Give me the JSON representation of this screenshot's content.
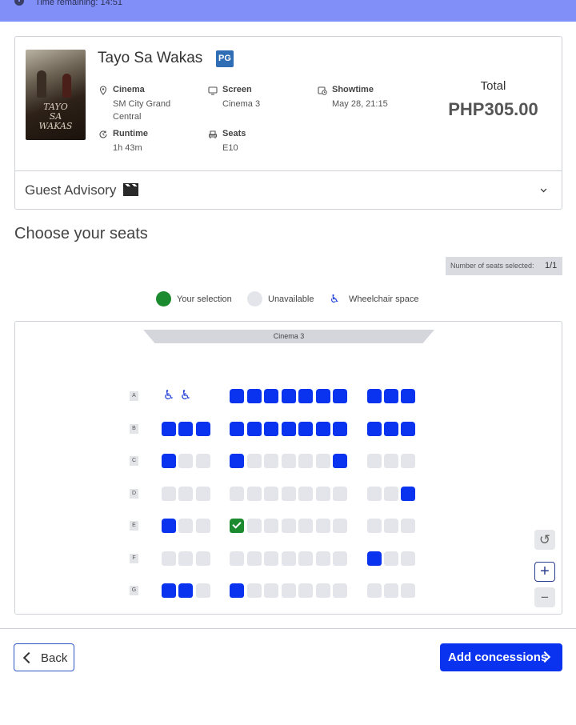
{
  "timer": {
    "text": "Time remaining: 14:51"
  },
  "movie": {
    "title": "Tayo Sa Wakas",
    "rating": "PG",
    "poster_title": "TAYO SA WAKAS",
    "cinema_label": "Cinema",
    "cinema_value": "SM City Grand Central",
    "screen_label": "Screen",
    "screen_value": "Cinema 3",
    "showtime_label": "Showtime",
    "showtime_value": "May 28, 21:15",
    "runtime_label": "Runtime",
    "runtime_value": "1h 43m",
    "seats_label": "Seats",
    "seats_value": "E10",
    "total_label": "Total",
    "total_value": "PHP305.00"
  },
  "advisory": {
    "label": "Guest Advisory"
  },
  "seat_selection": {
    "title": "Choose your seats",
    "count_label": "Number of seats selected:",
    "count_value": "1/1"
  },
  "legend": {
    "selection": "Your selection",
    "unavailable": "Unavailable",
    "wheelchair": "Wheelchair space",
    "colors": {
      "selection": "#1c8a2e",
      "unavailable": "#e4e5ea",
      "available": "#0a33f0"
    }
  },
  "seat_map": {
    "screen_label": "Cinema 3",
    "status_key": "w = wheelchair space, a = available, u = unavailable, s = your selection, - = no seat",
    "rows": [
      {
        "label": "A",
        "seats": "ww-aaaaaaaaaa"
      },
      {
        "label": "B",
        "seats": "aaaaaaaaaaaaa"
      },
      {
        "label": "C",
        "seats": "auuauuuuuauuu"
      },
      {
        "label": "D",
        "seats": "uuuuuuuuuuuua"
      },
      {
        "label": "E",
        "seats": "auusuuuuuuuuu"
      },
      {
        "label": "F",
        "seats": "uuuuuuuuuuauu"
      },
      {
        "label": "G",
        "seats": "aauauuuuuuuuu"
      }
    ]
  },
  "controls": {
    "reset_icon": "↺",
    "zoom_in": "+",
    "zoom_out": "−"
  },
  "footer": {
    "back_label": "Back",
    "next_label": "Add concessions"
  }
}
